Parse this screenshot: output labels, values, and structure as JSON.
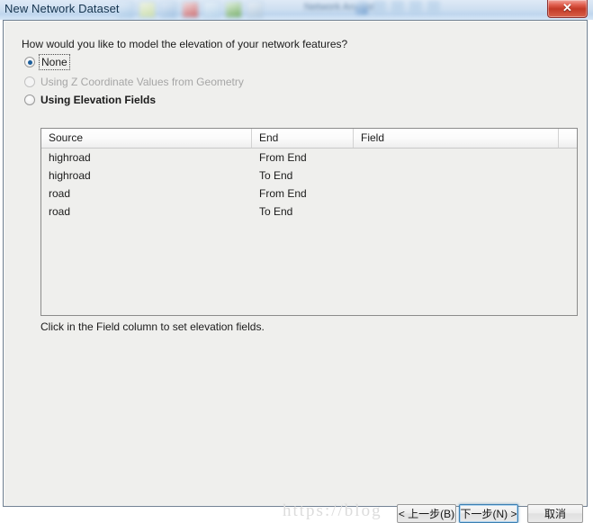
{
  "window": {
    "title": "New Network Dataset",
    "close_label": "✕",
    "background_app_text_1": "Network Analyst",
    "background_app_text_2": "     "
  },
  "dialog": {
    "question": "How would you like to model the elevation of your network features?",
    "hint": "Click in the Field column to set elevation fields.",
    "watermark": "https://blog"
  },
  "elevation_options": [
    {
      "label": "None",
      "selected": true,
      "enabled": true,
      "focused": true
    },
    {
      "label": "Using Z Coordinate Values from Geometry",
      "selected": false,
      "enabled": false,
      "focused": false
    },
    {
      "label": "Using Elevation Fields",
      "selected": false,
      "enabled": true,
      "focused": false
    }
  ],
  "table": {
    "columns": [
      "Source",
      "End",
      "Field",
      ""
    ],
    "rows": [
      {
        "source": "highroad",
        "end": "From End",
        "field": "",
        "extra": ""
      },
      {
        "source": "highroad",
        "end": "To End",
        "field": "",
        "extra": ""
      },
      {
        "source": "road",
        "end": "From End",
        "field": "",
        "extra": ""
      },
      {
        "source": "road",
        "end": "To End",
        "field": "",
        "extra": ""
      }
    ]
  },
  "footer": {
    "back_label": "< 上一步(B)",
    "next_label": "下一步(N) >",
    "cancel_label": "取消"
  },
  "colors": {
    "dialog_bg": "#efefed",
    "title_text": "#14334e",
    "close_red": "#c33a27",
    "focus_blue": "#3c7fb1",
    "radio_dot": "#1b5e9c"
  }
}
